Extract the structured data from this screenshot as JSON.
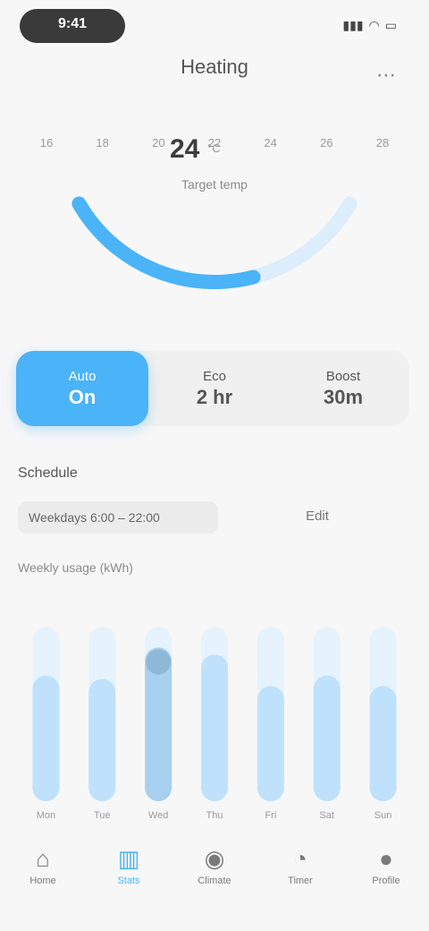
{
  "status_bar": {
    "time": "9:41",
    "icons": [
      "signal-icon",
      "wifi-icon",
      "battery-icon"
    ]
  },
  "header": {
    "title": "Heating",
    "action_icon": "settings-icon"
  },
  "gauge": {
    "value": "24",
    "unit": "°C",
    "label": "Target temp",
    "ticks": [
      "16",
      "18",
      "20",
      "22",
      "24",
      "26",
      "28"
    ],
    "level": 0.62,
    "colors": {
      "accent": "#4bb3f7",
      "track": "#dcedfb"
    }
  },
  "modes": [
    {
      "label": "Auto",
      "sub": "On",
      "active": true
    },
    {
      "label": "Eco",
      "sub": "2 hr",
      "active": false
    },
    {
      "label": "Boost",
      "sub": "30m",
      "active": false
    }
  ],
  "schedule": {
    "section_label": "Schedule",
    "input_value": "Weekdays 6:00 – 22:00",
    "side_value": "Edit",
    "sub_label": "Weekly usage (kWh)"
  },
  "chart_data": {
    "type": "bar",
    "categories": [
      "Mon",
      "Tue",
      "Wed",
      "Thu",
      "Fri",
      "Sat",
      "Sun"
    ],
    "values": [
      72,
      70,
      88,
      84,
      66,
      72,
      66
    ],
    "active_index": 2,
    "ylim": [
      0,
      100
    ]
  },
  "nav": [
    {
      "icon": "home-icon",
      "glyph": "⌂",
      "label": "Home",
      "active": false
    },
    {
      "icon": "chart-icon",
      "glyph": "▥",
      "label": "Stats",
      "active": true
    },
    {
      "icon": "thermostat-icon",
      "glyph": "◉",
      "label": "Climate",
      "active": false
    },
    {
      "icon": "schedule-icon",
      "glyph": "◔",
      "label": "Timer",
      "active": false
    },
    {
      "icon": "profile-icon",
      "glyph": "●",
      "label": "Profile",
      "active": false
    }
  ]
}
